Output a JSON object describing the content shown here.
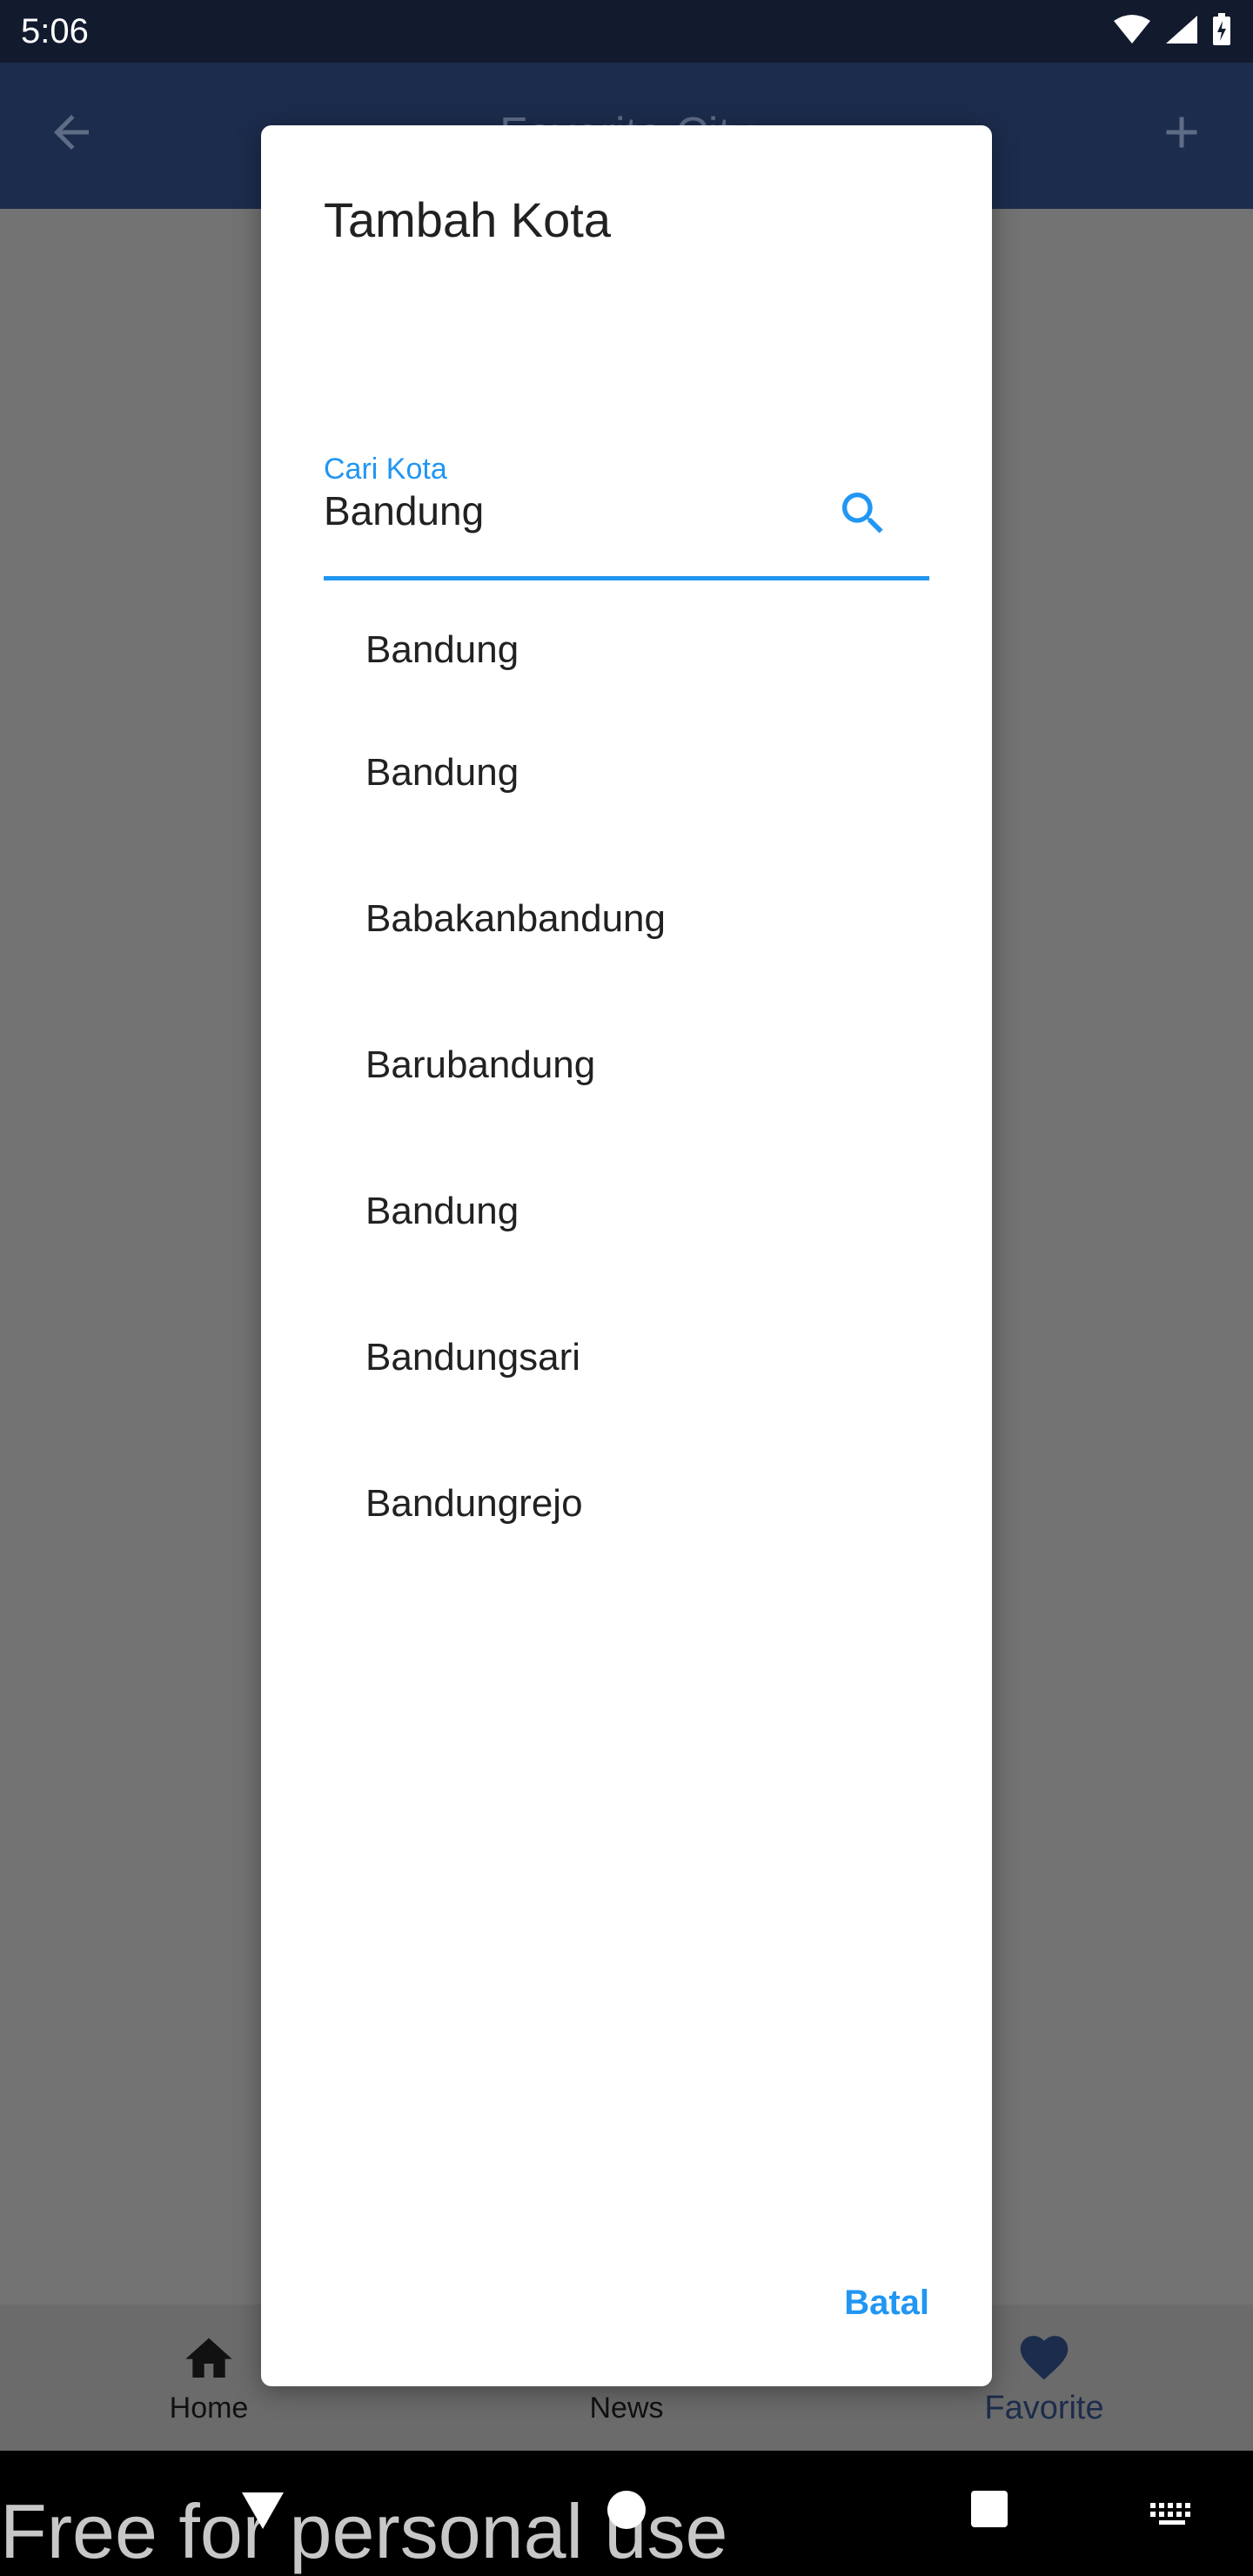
{
  "status_bar": {
    "time": "5:06"
  },
  "app_bar": {
    "title": "Favorite City"
  },
  "dialog": {
    "title": "Tambah Kota",
    "search": {
      "label": "Cari Kota",
      "value": "Bandung"
    },
    "results": [
      "Bandung",
      "Bandung",
      "Babakanbandung",
      "Barubandung",
      "Bandung",
      "Bandungsari",
      "Bandungrejo"
    ],
    "cancel_label": "Batal"
  },
  "bottom_nav": {
    "items": [
      {
        "label": "Home",
        "icon": "home-icon"
      },
      {
        "label": "News",
        "icon": "news-icon"
      },
      {
        "label": "Favorite",
        "icon": "heart-icon"
      }
    ]
  },
  "watermark": "Free for personal use",
  "colors": {
    "accent": "#2196f3",
    "app_bar": "#1c2c4c",
    "status_bar": "#121a2e"
  }
}
